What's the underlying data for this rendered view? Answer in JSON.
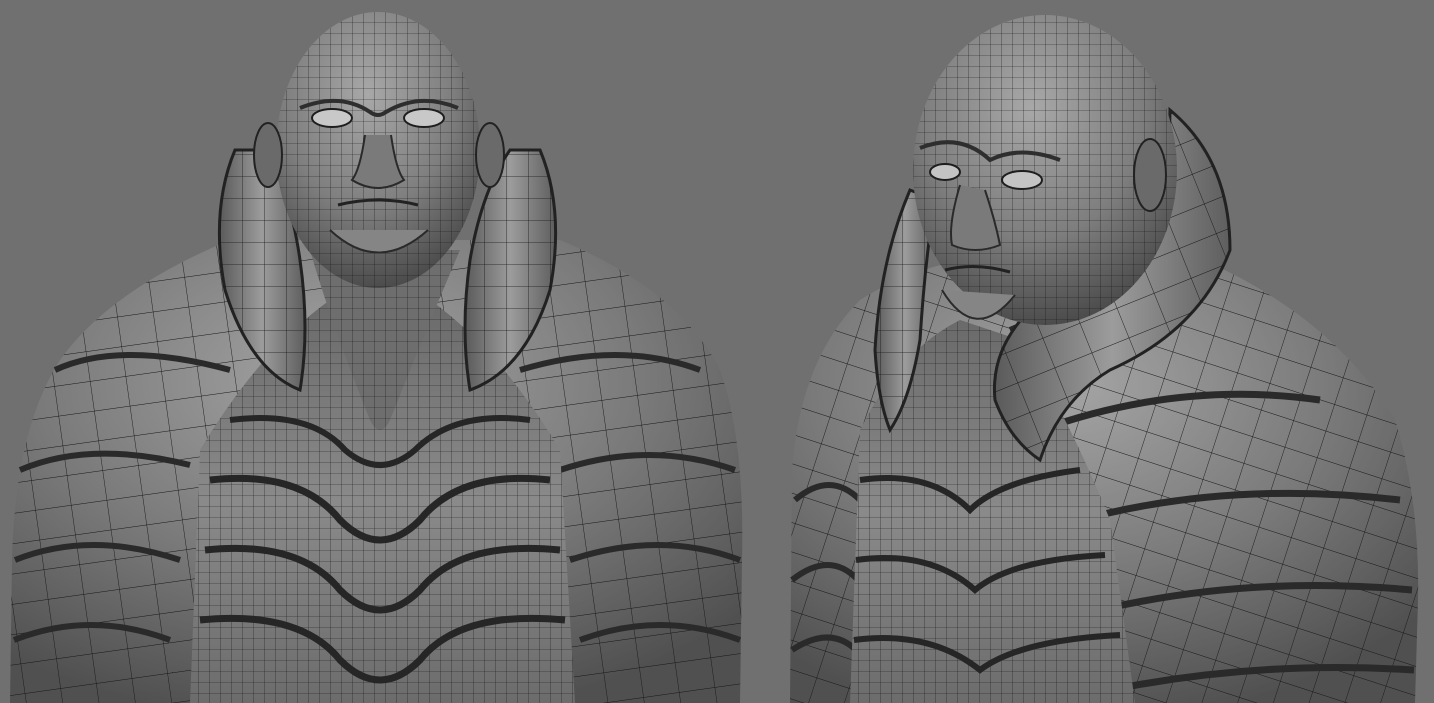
{
  "colors": {
    "background": "#707070",
    "surface_light": "#9a9a9a",
    "surface_mid": "#7c7c7c",
    "surface_dark": "#4a4a4a",
    "wire": "#141414"
  },
  "views": [
    {
      "name": "front"
    },
    {
      "name": "three-quarter"
    }
  ]
}
